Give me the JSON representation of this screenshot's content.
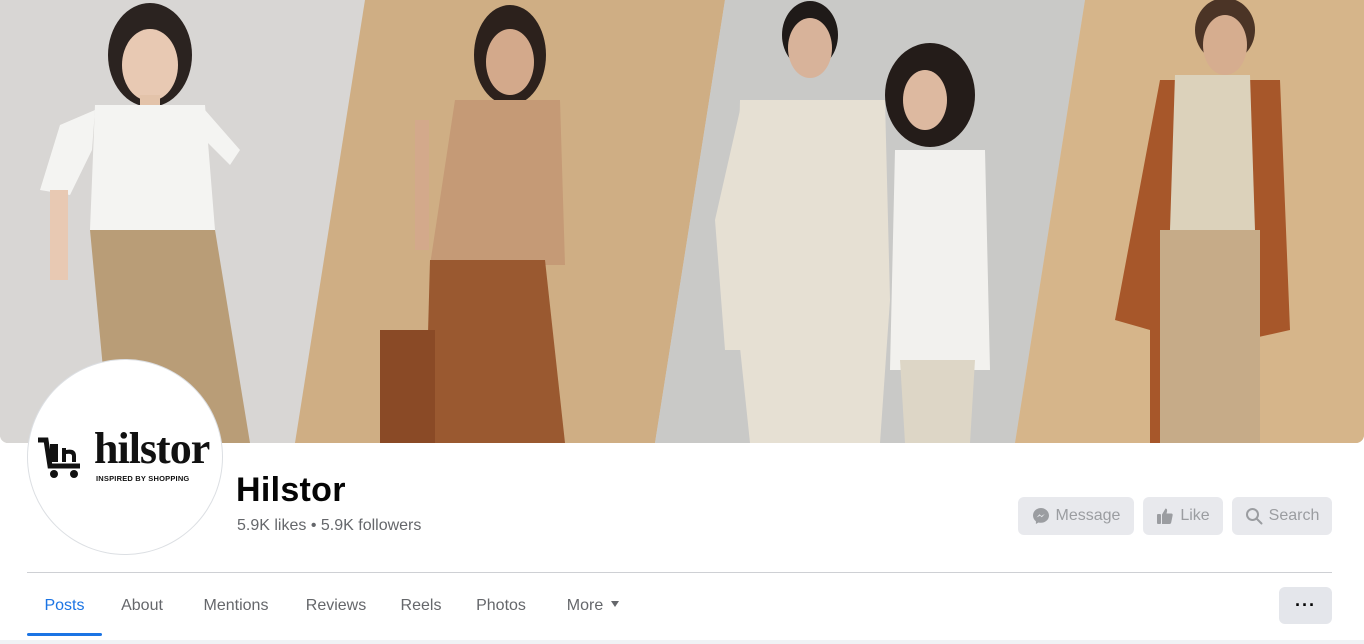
{
  "page": {
    "name": "Hilstor",
    "likes": "5.9K likes",
    "separator": "•",
    "followers": "5.9K followers"
  },
  "logo": {
    "word": "hilstor",
    "tagline": "INSPIRED BY SHOPPING"
  },
  "actions": {
    "message_label": "Message",
    "like_label": "Like",
    "search_label": "Search"
  },
  "tabs": [
    {
      "label": "Posts",
      "active": true
    },
    {
      "label": "About"
    },
    {
      "label": "Mentions"
    },
    {
      "label": "Reviews"
    },
    {
      "label": "Reels"
    },
    {
      "label": "Photos"
    },
    {
      "label": "More"
    }
  ],
  "more_menu_label": "···",
  "colors": {
    "accent": "#1b74e4",
    "secondary_text": "#65676b",
    "button_bg": "#e4e6eb"
  }
}
